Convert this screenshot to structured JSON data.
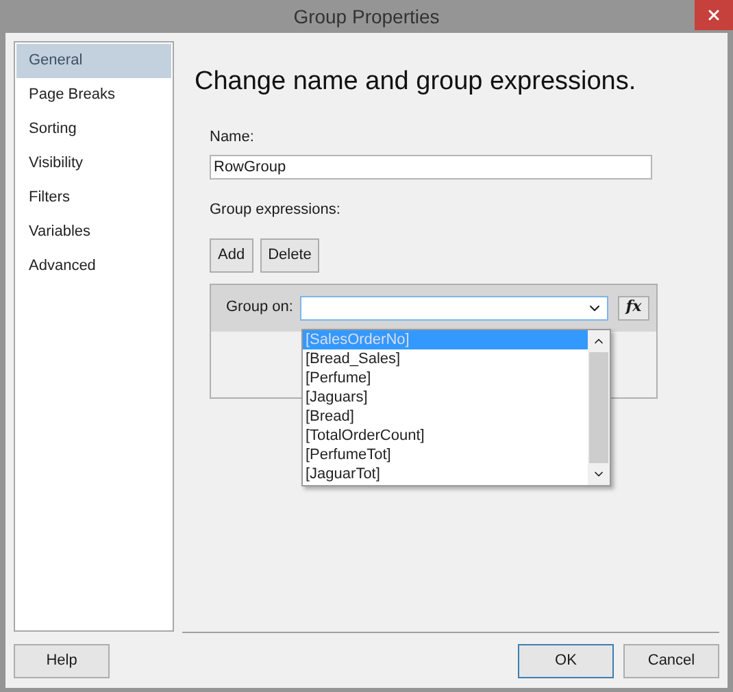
{
  "window": {
    "title": "Group Properties"
  },
  "sidebar": {
    "items": [
      {
        "label": "General",
        "selected": true
      },
      {
        "label": "Page Breaks",
        "selected": false
      },
      {
        "label": "Sorting",
        "selected": false
      },
      {
        "label": "Visibility",
        "selected": false
      },
      {
        "label": "Filters",
        "selected": false
      },
      {
        "label": "Variables",
        "selected": false
      },
      {
        "label": "Advanced",
        "selected": false
      }
    ]
  },
  "heading": "Change name and group expressions.",
  "name_field": {
    "label": "Name:",
    "value": "RowGroup"
  },
  "group_expressions": {
    "label": "Group expressions:",
    "buttons": [
      "Add",
      "Delete"
    ],
    "group_on_label": "Group on:",
    "expression_button": "fx",
    "dropdown_options": [
      {
        "label": "[SalesOrderNo]",
        "selected": true
      },
      {
        "label": "[Bread_Sales]",
        "selected": false
      },
      {
        "label": "[Perfume]",
        "selected": false
      },
      {
        "label": "[Jaguars]",
        "selected": false
      },
      {
        "label": "[Bread]",
        "selected": false
      },
      {
        "label": "[TotalOrderCount]",
        "selected": false
      },
      {
        "label": "[PerfumeTot]",
        "selected": false
      },
      {
        "label": "[JaguarTot]",
        "selected": false
      }
    ]
  },
  "footer": {
    "help": "Help",
    "ok": "OK",
    "cancel": "Cancel"
  }
}
